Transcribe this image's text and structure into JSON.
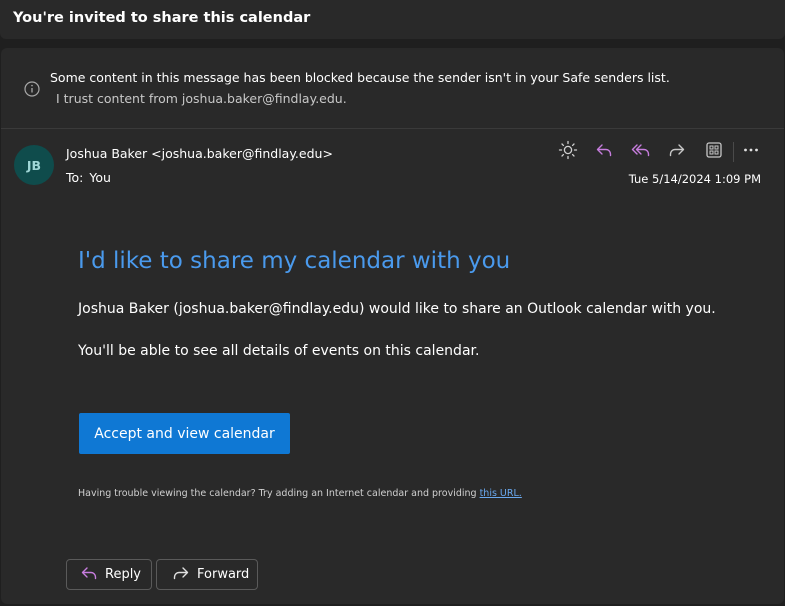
{
  "subject": "You're invited to share this calendar",
  "blocked_notice": {
    "message": "Some content in this message has been blocked because the sender isn't in your Safe senders list.",
    "trust_link": "I trust content from joshua.baker@findlay.edu."
  },
  "sender": {
    "initials": "JB",
    "display": "Joshua Baker <joshua.baker@findlay.edu>",
    "to_label": "To:",
    "to_value": "You",
    "timestamp": "Tue 5/14/2024 1:09 PM"
  },
  "body": {
    "heading": "I'd like to share my calendar with you",
    "paragraph1": "Joshua Baker (joshua.baker@findlay.edu) would like to share an Outlook calendar with you.",
    "paragraph2": "You'll be able to see all details of events on this calendar.",
    "accept_label": "Accept and view calendar",
    "trouble_text": "Having trouble viewing the calendar? Try adding an Internet calendar and providing ",
    "trouble_link": "this URL."
  },
  "actions": {
    "reply_label": "Reply",
    "forward_label": "Forward"
  },
  "colors": {
    "accent": "#0f78d4",
    "heading": "#4a9aed",
    "reply_icon": "#c77dde",
    "avatar_bg": "#0f4c4c"
  }
}
